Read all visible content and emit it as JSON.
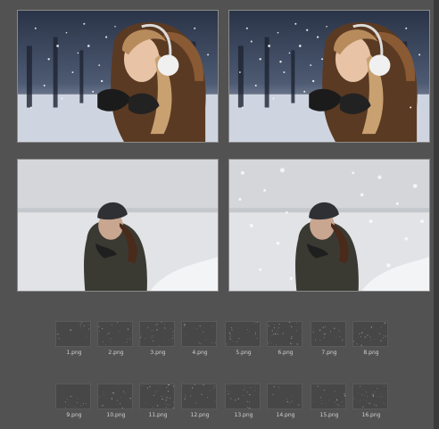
{
  "colors": {
    "background": "#525252",
    "thumb_fill": "#474747",
    "label_text": "#d2d2d2"
  },
  "previews": [
    {
      "name": "winter-woman-earmuffs-original",
      "icon": "photo-icon"
    },
    {
      "name": "winter-woman-earmuffs-snow-overlay",
      "icon": "photo-icon"
    },
    {
      "name": "woman-beanie-snowfield-original",
      "icon": "photo-icon"
    },
    {
      "name": "woman-beanie-snowfield-snow-overlay",
      "icon": "photo-icon"
    }
  ],
  "files": [
    {
      "label": "1.png"
    },
    {
      "label": "2.png"
    },
    {
      "label": "3.png"
    },
    {
      "label": "4.png"
    },
    {
      "label": "5.png"
    },
    {
      "label": "6.png"
    },
    {
      "label": "7.png"
    },
    {
      "label": "8.png"
    },
    {
      "label": "9.png"
    },
    {
      "label": "10.png"
    },
    {
      "label": "11.png"
    },
    {
      "label": "12.png"
    },
    {
      "label": "13.png"
    },
    {
      "label": "14.png"
    },
    {
      "label": "15.png"
    },
    {
      "label": "16.png"
    }
  ]
}
